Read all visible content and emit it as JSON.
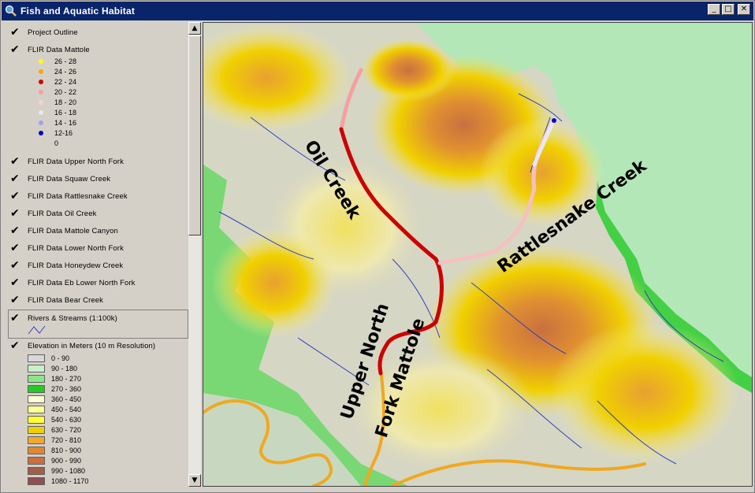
{
  "window": {
    "title": "Fish and Aquatic Habitat",
    "controls": [
      "minimize",
      "maximize",
      "close"
    ],
    "app_icon": "magnifier-globe-icon"
  },
  "toc": {
    "layers": [
      {
        "name": "Project Outline",
        "checked": true
      },
      {
        "name": "FLIR Data Mattole",
        "checked": true
      },
      {
        "name": "FLIR Data Upper North Fork",
        "checked": true
      },
      {
        "name": "FLIR Data Squaw Creek",
        "checked": true
      },
      {
        "name": "FLIR Data Rattlesnake Creek",
        "checked": true
      },
      {
        "name": "FLIR Data Oil Creek",
        "checked": true
      },
      {
        "name": "FLIR Data Mattole Canyon",
        "checked": true
      },
      {
        "name": "FLIR Data Lower North Fork",
        "checked": true
      },
      {
        "name": "FLIR Data Honeydew Creek",
        "checked": true
      },
      {
        "name": "FLIR Data Eb Lower North Fork",
        "checked": true
      },
      {
        "name": "FLIR Data Bear Creek",
        "checked": true
      },
      {
        "name": "Rivers & Streams (1:100k)",
        "checked": true
      },
      {
        "name": "Elevation in Meters (10 m Resolution)",
        "checked": true
      }
    ],
    "flir_legend": [
      {
        "label": "26 - 28",
        "color": "#ffff00"
      },
      {
        "label": "24 - 26",
        "color": "#ffa500"
      },
      {
        "label": "22 - 24",
        "color": "#cc0000"
      },
      {
        "label": "20 - 22",
        "color": "#f4a0a0"
      },
      {
        "label": "18 - 20",
        "color": "#f8d0d0"
      },
      {
        "label": "16 - 18",
        "color": "#e8e8f4"
      },
      {
        "label": "14 - 16",
        "color": "#a0a0e8"
      },
      {
        "label": "12-16",
        "color": "#0000cc"
      },
      {
        "label": "0",
        "color": ""
      }
    ],
    "elevation_legend": [
      {
        "label": "0 - 90",
        "color": "#d8d8d8"
      },
      {
        "label": "90 - 180",
        "color": "#c8f0c8"
      },
      {
        "label": "180 - 270",
        "color": "#88e888"
      },
      {
        "label": "270 - 360",
        "color": "#22cc22"
      },
      {
        "label": "360 - 450",
        "color": "#ffffd8"
      },
      {
        "label": "450 - 540",
        "color": "#ffff99"
      },
      {
        "label": "540 - 630",
        "color": "#ffff33"
      },
      {
        "label": "630 - 720",
        "color": "#f0d000"
      },
      {
        "label": "720 - 810",
        "color": "#f0a830"
      },
      {
        "label": "810 - 900",
        "color": "#e08830"
      },
      {
        "label": "900 - 990",
        "color": "#c87040"
      },
      {
        "label": "990 - 1080",
        "color": "#a06048"
      },
      {
        "label": "1080 - 1170",
        "color": "#905050"
      }
    ]
  },
  "map": {
    "labels": {
      "oil_creek": "Oil Creek",
      "rattlesnake_creek": "Rattlesnake Creek",
      "upper_north": "Upper North",
      "fork_mattole": "Fork Mattole"
    },
    "colors": {
      "background": "#b3e7b7",
      "terrain_low": "#d8d8c8",
      "terrain_mid": "#e8e070",
      "terrain_high": "#d49030",
      "stream": "#3040c0"
    }
  }
}
